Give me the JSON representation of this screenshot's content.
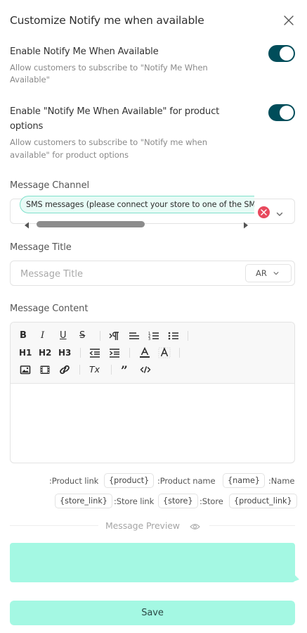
{
  "modal": {
    "title": "Customize Notify me when available"
  },
  "settings": [
    {
      "title": "Enable Notify Me When Available",
      "description_line1": "Allow customers to subscribe to \"Notify Me When",
      "description_line2": "Available\"",
      "enabled": true
    },
    {
      "title_line1": "Enable \"Notify Me When Available\" for product",
      "title_line2": "options",
      "description_line1": "Allow customers to subscribe to \"Notify me when",
      "description_line2": "available\" for product options",
      "enabled": true
    }
  ],
  "channel": {
    "label": "Message Channel",
    "selected": "SMS messages (please connect your store to one of the SMS providers)"
  },
  "message_title": {
    "label": "Message Title",
    "placeholder": "Message Title",
    "language": "AR"
  },
  "content": {
    "label": "Message Content",
    "toolbar": {
      "bold": "B",
      "italic": "I",
      "underline": "U",
      "strike": "S",
      "h1": "H1",
      "h2": "H2",
      "h3": "H3",
      "clear_format": "Tx",
      "quote": "”"
    }
  },
  "variables": {
    "row1": [
      {
        "label": ":Product link",
        "token": "{product}"
      },
      {
        "label": ":Product name",
        "token": "{name}"
      },
      {
        "label": ":Name",
        "token": ""
      }
    ],
    "row2": [
      {
        "token": "{store_link}",
        "label": ":Store link"
      },
      {
        "token": "{store}",
        "label": ":Store"
      },
      {
        "token": "{product_link}",
        "label": ""
      }
    ]
  },
  "preview": {
    "label": "Message Preview",
    "background": "#a4f8e3"
  },
  "actions": {
    "save_label": "Save"
  },
  "colors": {
    "toggle_on": "#004d5a",
    "accent": "#a4f8e3",
    "chip_border": "#7fe0cb",
    "clear_red": "#e8495d"
  }
}
